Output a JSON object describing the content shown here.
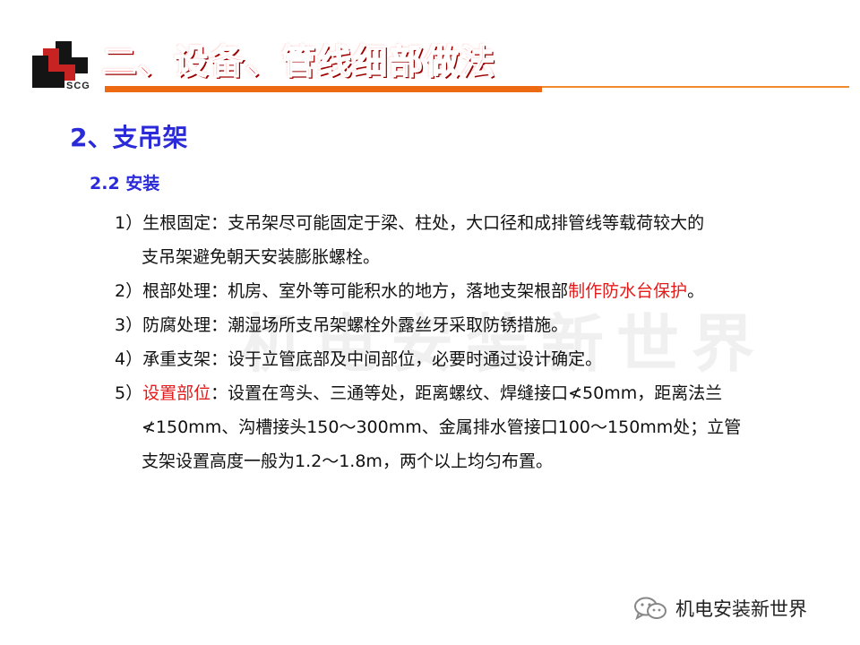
{
  "header": {
    "logo_text": "SCG",
    "title": "二、设备、管线细部做法"
  },
  "section": {
    "heading": "2、支吊架",
    "subheading": "2.2  安装"
  },
  "watermark": "机电安装新世界",
  "items": [
    {
      "num": "1）",
      "label": "生根固定：",
      "line1": "支吊架尽可能固定于梁、柱处，大口径和成排管线等载荷较大的",
      "line2": "支吊架避免朝天安装膨胀螺栓。"
    },
    {
      "num": "2）",
      "label": "根部处理：",
      "text": "机房、室外等可能积水的地方，落地支架根部",
      "highlight": "制作防水台保护",
      "end": "。"
    },
    {
      "num": "3）",
      "label": "防腐处理：",
      "text": "潮湿场所支吊架螺栓外露丝牙采取防锈措施。"
    },
    {
      "num": "4）",
      "label": "承重支架：",
      "text": "设于立管底部及中间部位，必要时通过设计确定。"
    },
    {
      "num": "5）",
      "highlight_label": "设置部位",
      "colon": "：",
      "line1": "设置在弯头、三通等处，距离螺纹、焊缝接口≮50mm，距离法兰",
      "line2": "≮150mm、沟槽接头150～300mm、金属排水管接口100～150mm处；立管",
      "line3": "支架设置高度一般为1.2～1.8m，两个以上均匀布置。"
    }
  ],
  "footer": {
    "icon": "wechat-icon",
    "text": "机电安装新世界"
  },
  "colors": {
    "title_red": "#ff2e2e",
    "heading_blue": "#2a2ad8",
    "highlight_red": "#e41a1a",
    "rule_orange": "#ee6a12"
  }
}
